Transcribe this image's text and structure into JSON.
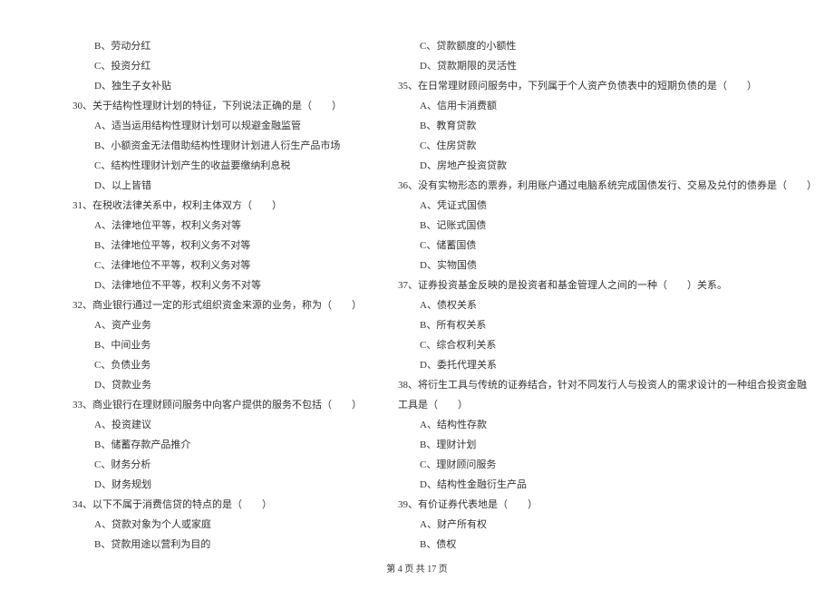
{
  "leftColumn": [
    {
      "type": "option",
      "text": "B、劳动分红"
    },
    {
      "type": "option",
      "text": "C、投资分红"
    },
    {
      "type": "option",
      "text": "D、独生子女补贴"
    },
    {
      "type": "question",
      "text": "30、关于结构性理财计划的特征，下列说法正确的是（　　）"
    },
    {
      "type": "option",
      "text": "A、适当运用结构性理财计划可以规避金融监管"
    },
    {
      "type": "option",
      "text": "B、小额资金无法借助结构性理财计划进人衍生产品市场"
    },
    {
      "type": "option",
      "text": "C、结构性理财计划产生的收益要缴纳利息税"
    },
    {
      "type": "option",
      "text": "D、以上皆错"
    },
    {
      "type": "question",
      "text": "31、在税收法律关系中，权利主体双方（　　）"
    },
    {
      "type": "option",
      "text": "A、法律地位平等，权利义务对等"
    },
    {
      "type": "option",
      "text": "B、法律地位平等，权利义务不对等"
    },
    {
      "type": "option",
      "text": "C、法律地位不平等，权利义务对等"
    },
    {
      "type": "option",
      "text": "D、法律地位不平等，权利义务不对等"
    },
    {
      "type": "question",
      "text": "32、商业银行通过一定的形式组织资金来源的业务，称为（　　）"
    },
    {
      "type": "option",
      "text": "A、资产业务"
    },
    {
      "type": "option",
      "text": "B、中间业务"
    },
    {
      "type": "option",
      "text": "C、负债业务"
    },
    {
      "type": "option",
      "text": "D、贷款业务"
    },
    {
      "type": "question",
      "text": "33、商业银行在理财顾问服务中向客户提供的服务不包括（　　）"
    },
    {
      "type": "option",
      "text": "A、投资建议"
    },
    {
      "type": "option",
      "text": "B、储蓄存款产品推介"
    },
    {
      "type": "option",
      "text": "C、财务分析"
    },
    {
      "type": "option",
      "text": "D、财务规划"
    },
    {
      "type": "question",
      "text": "34、以下不属于消费信贷的特点的是（　　）"
    },
    {
      "type": "option",
      "text": "A、贷款对象为个人或家庭"
    },
    {
      "type": "option",
      "text": "B、贷款用途以营利为目的"
    }
  ],
  "rightColumn": [
    {
      "type": "option",
      "text": "C、贷款额度的小额性"
    },
    {
      "type": "option",
      "text": "D、贷款期限的灵活性"
    },
    {
      "type": "question",
      "text": "35、在日常理财顾问服务中，下列属于个人资产负债表中的短期负债的是（　　）"
    },
    {
      "type": "option",
      "text": "A、信用卡消费额"
    },
    {
      "type": "option",
      "text": "B、教育贷款"
    },
    {
      "type": "option",
      "text": "C、住房贷款"
    },
    {
      "type": "option",
      "text": "D、房地产投资贷款"
    },
    {
      "type": "question",
      "text": "36、没有实物形态的票券，利用账户通过电脑系统完成国债发行、交易及兑付的债券是（　　）"
    },
    {
      "type": "option",
      "text": "A、凭证式国债"
    },
    {
      "type": "option",
      "text": "B、记账式国债"
    },
    {
      "type": "option",
      "text": "C、储蓄国债"
    },
    {
      "type": "option",
      "text": "D、实物国债"
    },
    {
      "type": "question",
      "text": "37、证券投资基金反映的是投资者和基金管理人之间的一种（　　）关系。"
    },
    {
      "type": "option",
      "text": "A、债权关系"
    },
    {
      "type": "option",
      "text": "B、所有权关系"
    },
    {
      "type": "option",
      "text": "C、综合权利关系"
    },
    {
      "type": "option",
      "text": "D、委托代理关系"
    },
    {
      "type": "question",
      "text": "38、将衍生工具与传统的证券结合，针对不同发行人与投资人的需求设计的一种组合投资金融"
    },
    {
      "type": "continuation",
      "text": "工具是（　　）"
    },
    {
      "type": "option",
      "text": "A、结构性存款"
    },
    {
      "type": "option",
      "text": "B、理财计划"
    },
    {
      "type": "option",
      "text": "C、理财顾问服务"
    },
    {
      "type": "option",
      "text": "D、结构性金融衍生产品"
    },
    {
      "type": "question",
      "text": "39、有价证券代表地是（　　）"
    },
    {
      "type": "option",
      "text": "A、财产所有权"
    },
    {
      "type": "option",
      "text": "B、债权"
    }
  ],
  "footer": "第 4 页 共 17 页"
}
